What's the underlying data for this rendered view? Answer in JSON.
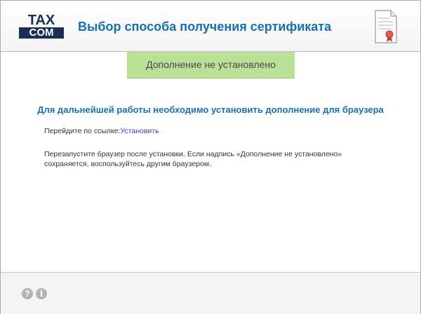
{
  "header": {
    "logo": {
      "top": "TAX",
      "bottom": "COM"
    },
    "title": "Выбор способа получения сертификата",
    "certificate_icon": "certificate-document-icon"
  },
  "status": {
    "text": "Дополнение не установлено",
    "color": "#a9d67d"
  },
  "main": {
    "heading": "Для дальнейшей работы необходимо установить дополнение для браузера",
    "link_row": {
      "prefix": "Перейдите по ссылке:",
      "link_label": "Установить"
    },
    "note": "Перезапустите браузер после установки. Если надпись «Дополнение не установлено» сохраняется, воспользуйтесь другим браузером."
  },
  "footer": {
    "help_icon": "question-icon",
    "help_glyph": "?",
    "info_icon": "info-icon",
    "info_glyph": "i"
  },
  "colors": {
    "accent": "#1b6fae",
    "link": "#3d3dc8",
    "brand": "#1b2f56"
  }
}
